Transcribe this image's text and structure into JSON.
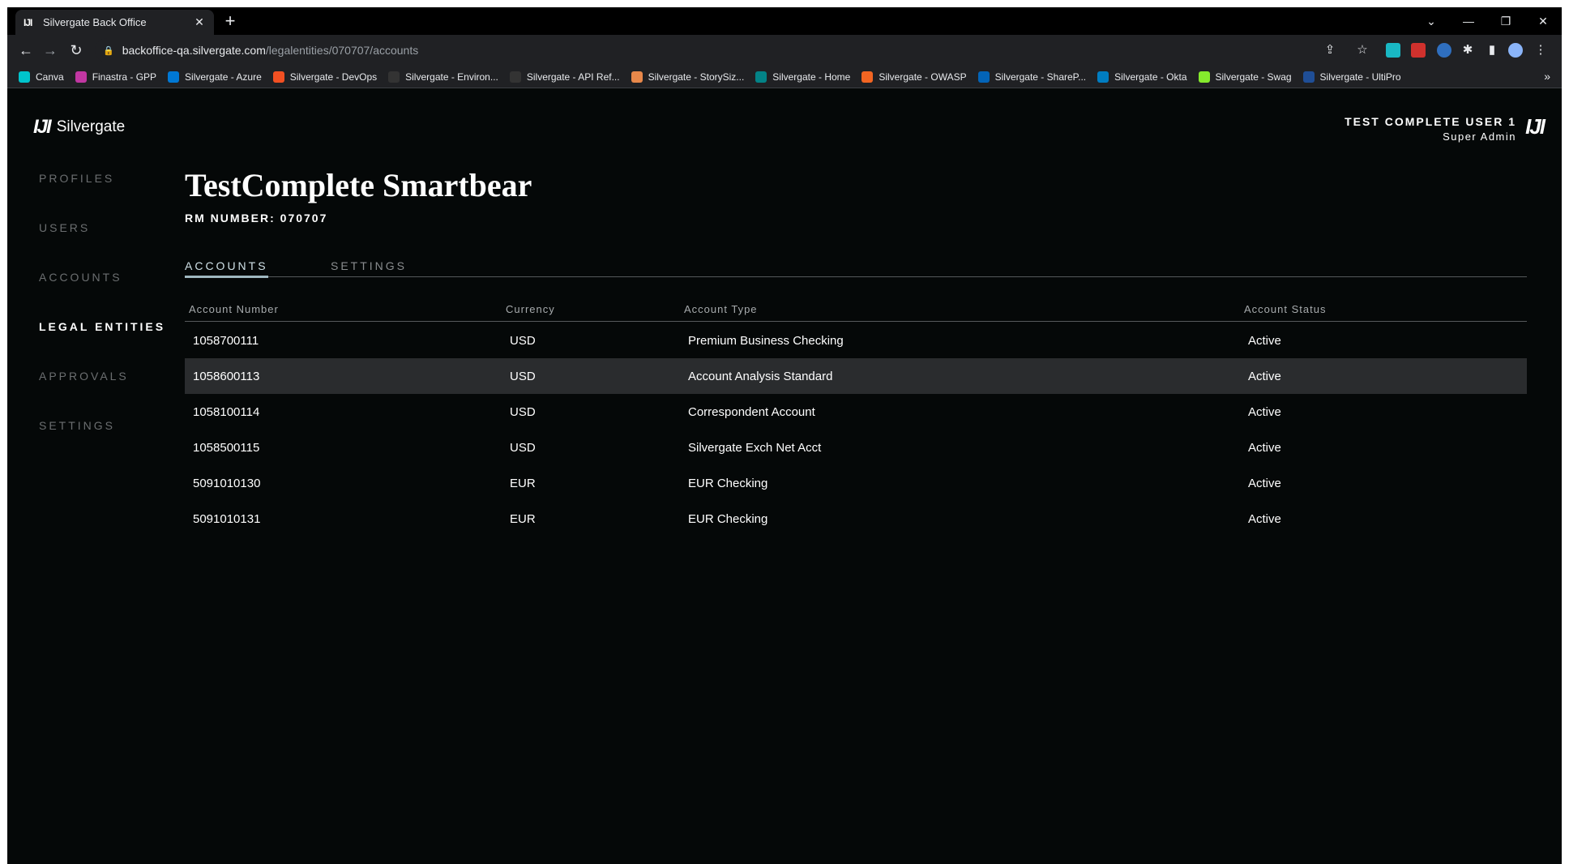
{
  "browser": {
    "tab_title": "Silvergate Back Office",
    "tab_favicon": "IJI",
    "url_host": "backoffice-qa.silvergate.com",
    "url_path": "/legalentities/070707/accounts",
    "bookmarks": [
      {
        "label": "Canva",
        "color": "#00c4cc"
      },
      {
        "label": "Finastra - GPP",
        "color": "#c137a2"
      },
      {
        "label": "Silvergate - Azure",
        "color": "#0078d4"
      },
      {
        "label": "Silvergate - DevOps",
        "color": "#f25022"
      },
      {
        "label": "Silvergate - Environ...",
        "color": "#333333"
      },
      {
        "label": "Silvergate - API Ref...",
        "color": "#333333"
      },
      {
        "label": "Silvergate - StorySiz...",
        "color": "#e8884a"
      },
      {
        "label": "Silvergate - Home",
        "color": "#038387"
      },
      {
        "label": "Silvergate - OWASP",
        "color": "#f26522"
      },
      {
        "label": "Silvergate - ShareP...",
        "color": "#0364b8"
      },
      {
        "label": "Silvergate - Okta",
        "color": "#007dc1"
      },
      {
        "label": "Silvergate - Swag",
        "color": "#85ea2d"
      },
      {
        "label": "Silvergate - UltiPro",
        "color": "#1f4e96"
      }
    ],
    "bookmarks_more": "»"
  },
  "header": {
    "logo_mark": "IJI",
    "logo_text": "Silvergate",
    "user_name": "TEST COMPLETE USER 1",
    "user_role": "Super Admin"
  },
  "sidebar": {
    "items": [
      {
        "label": "PROFILES"
      },
      {
        "label": "USERS"
      },
      {
        "label": "ACCOUNTS"
      },
      {
        "label": "LEGAL ENTITIES"
      },
      {
        "label": "APPROVALS"
      },
      {
        "label": "SETTINGS"
      }
    ]
  },
  "main": {
    "title": "TestComplete Smartbear",
    "rm_number": "RM NUMBER: 070707",
    "tabs": [
      {
        "label": "ACCOUNTS"
      },
      {
        "label": "SETTINGS"
      }
    ],
    "columns": [
      "Account Number",
      "Currency",
      "Account Type",
      "Account Status"
    ],
    "rows": [
      [
        "1058700111",
        "USD",
        "Premium Business Checking",
        "Active"
      ],
      [
        "1058600113",
        "USD",
        "Account Analysis Standard",
        "Active"
      ],
      [
        "1058100114",
        "USD",
        "Correspondent Account",
        "Active"
      ],
      [
        "1058500115",
        "USD",
        "Silvergate Exch Net Acct",
        "Active"
      ],
      [
        "5091010130",
        "EUR",
        "EUR Checking",
        "Active"
      ],
      [
        "5091010131",
        "EUR",
        "EUR Checking",
        "Active"
      ]
    ]
  }
}
